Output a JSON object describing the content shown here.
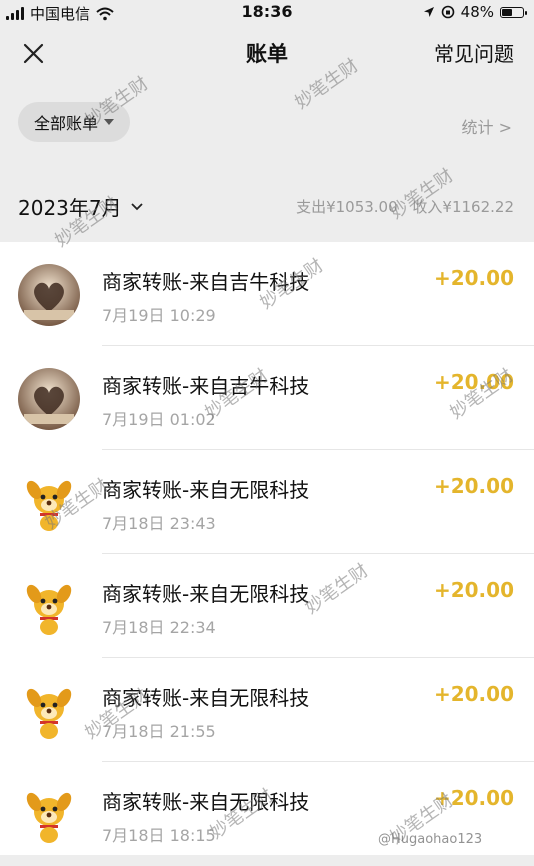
{
  "status_bar": {
    "carrier": "中国电信",
    "time": "18:36",
    "battery": "48%",
    "battery_level": 0.48
  },
  "nav": {
    "title": "账单",
    "faq": "常见问题"
  },
  "filter": {
    "label": "全部账单",
    "stats": "统计 >"
  },
  "month": {
    "label": "2023年7月",
    "expense": "支出¥1053.00",
    "income": "收入¥1162.22"
  },
  "transactions": [
    {
      "title": "商家转账-来自吉牛科技",
      "time": "7月19日 10:29",
      "amount": "+20.00",
      "avatar": "book-heart-avatar"
    },
    {
      "title": "商家转账-来自吉牛科技",
      "time": "7月19日 01:02",
      "amount": "+20.00",
      "avatar": "book-heart-avatar"
    },
    {
      "title": "商家转账-来自无限科技",
      "time": "7月18日 23:43",
      "amount": "+20.00",
      "avatar": "dog-avatar"
    },
    {
      "title": "商家转账-来自无限科技",
      "time": "7月18日 22:34",
      "amount": "+20.00",
      "avatar": "dog-avatar"
    },
    {
      "title": "商家转账-来自无限科技",
      "time": "7月18日 21:55",
      "amount": "+20.00",
      "avatar": "dog-avatar"
    },
    {
      "title": "商家转账-来自无限科技",
      "time": "7月18日 18:15",
      "amount": "+20.00",
      "avatar": "dog-avatar"
    }
  ],
  "watermark": {
    "text": "妙笔生财",
    "credit": "@Hugaohao123"
  }
}
